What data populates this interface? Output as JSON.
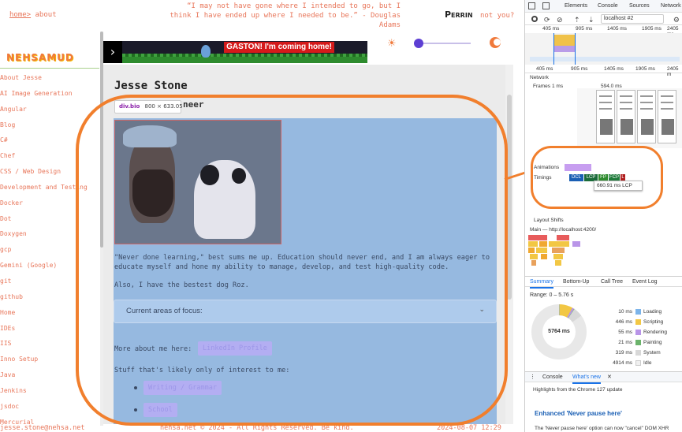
{
  "site": {
    "breadcrumb": {
      "home": "home>",
      "current": "about"
    },
    "quote": "“I may not have gone where I intended to go, but I think I have ended up where I needed to be.” - Douglas Adams",
    "user": {
      "name": "Perrin",
      "prompt": "not you?"
    },
    "logo": "NEHSAMUD",
    "nav": [
      "About Jesse",
      "AI Image Generation",
      "Angular",
      "Blog",
      "C#",
      "Chef",
      "CSS / Web Design",
      "Development and Testing",
      "Docker",
      "Dot",
      "Doxygen",
      "gcp",
      "Gemini (Google)",
      "git",
      "github",
      "Home",
      "IDEs",
      "IIS",
      "Inno Setup",
      "Java",
      "Jenkins",
      "jsdoc",
      "Mercurial"
    ],
    "email": "jesse.stone@nehsa.net",
    "banner": {
      "message": "GASTON! I'm coming home!",
      "arrow": "›"
    },
    "theme": {
      "sun": "☀",
      "slider_value": 0.0
    },
    "page_title": "Jesse Stone",
    "subtitle_visible": "neer",
    "inspector_tooltip": {
      "name": "div.bio",
      "dims": "800 × 633.05"
    },
    "bio_paragraph_1": "\"Never done learning,\" best sums me up. Education should never end, and I am always eager to educate myself and hone my ability to manage, develop, and test high-quality code.",
    "bio_paragraph_2": "Also, I have the bestest dog Roz.",
    "focus_label": "Current areas of focus:",
    "focus_chevron": "⌄",
    "more_label": "More about me here:",
    "linkedin": "LinkedIn Profile",
    "stuff_label": "Stuff that's likely only of interest to me:",
    "interests": [
      "Writing / Grammar",
      "School"
    ],
    "footer": "nehsa.net © 2024 - All Rights Reserved. Be kind.",
    "footer_date": "2024-08-07 12:29"
  },
  "devtools": {
    "tabs": [
      "Elements",
      "Console",
      "Sources",
      "Network"
    ],
    "host": "localhost #2",
    "overview_ticks": [
      "405 ms",
      "905 ms",
      "1405 ms",
      "1905 ms",
      "2405 ms"
    ],
    "ruler_ticks": [
      "405 ms",
      "905 ms",
      "1405 ms",
      "1905 ms",
      "2405 m"
    ],
    "rows": {
      "network": "Network",
      "frames": "Frames",
      "frames_time": "1 ms",
      "frames_time2": "594.0 ms",
      "animations": "Animations",
      "timings": "Timings",
      "layout_shifts": "Layout Shifts",
      "main": "Main — http://localhost:4200/"
    },
    "timings": [
      "DCL",
      "LCP",
      "FP",
      "FCP",
      "L"
    ],
    "lcp_tooltip": "660.91 ms  LCP",
    "summary_tabs": [
      "Summary",
      "Bottom-Up",
      "Call Tree",
      "Event Log"
    ],
    "range": "Range: 0 – 5.76 s",
    "total": "5764 ms",
    "legend": [
      {
        "value": "10 ms",
        "name": "Loading",
        "color": "#7cb4ea"
      },
      {
        "value": "446 ms",
        "name": "Scripting",
        "color": "#f2c744"
      },
      {
        "value": "55 ms",
        "name": "Rendering",
        "color": "#b995e8"
      },
      {
        "value": "21 ms",
        "name": "Painting",
        "color": "#6bb36b"
      },
      {
        "value": "319 ms",
        "name": "System",
        "color": "#d8d8d8"
      },
      {
        "value": "4914 ms",
        "name": "Idle",
        "color": "#f0f0f0"
      }
    ],
    "drawer_tabs": [
      "Console",
      "What's new",
      "✕"
    ],
    "highlights": "Highlights from the Chrome 127 update",
    "enhanced": "Enhanced 'Never pause here'",
    "never_pause": "The 'Never pause here' option can now \"cancel\" DOM XHR"
  }
}
